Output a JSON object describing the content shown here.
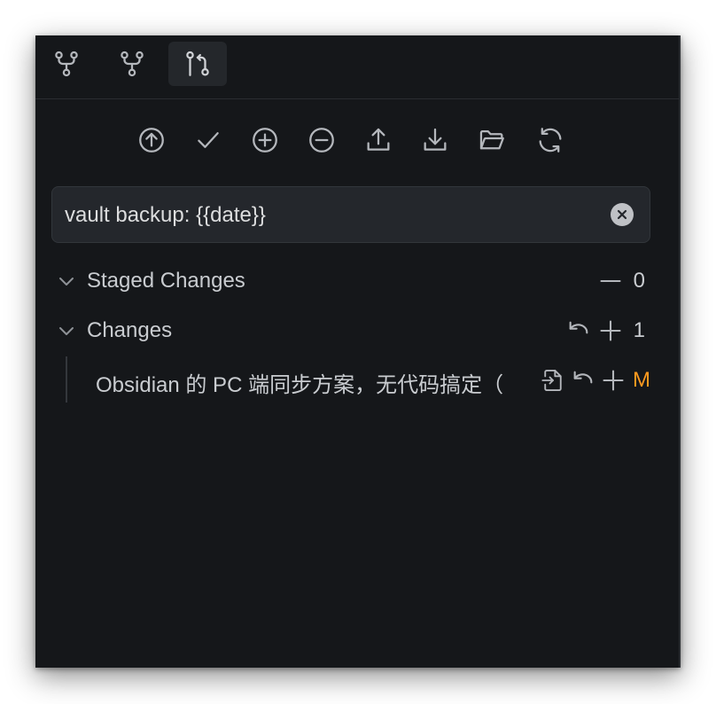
{
  "tabs": [
    {
      "name": "source-control-branch-tab",
      "icon": "git-fork-icon",
      "active": false
    },
    {
      "name": "source-control-fork-tab",
      "icon": "git-fork-icon",
      "active": false
    },
    {
      "name": "source-control-tab",
      "icon": "git-pull-request-icon",
      "active": true
    }
  ],
  "toolbar": {
    "icons": [
      "push-icon",
      "commit-check-icon",
      "stage-all-icon",
      "unstage-all-icon",
      "upload-icon",
      "download-icon",
      "folder-open-icon",
      "refresh-icon"
    ]
  },
  "commit": {
    "message": "vault backup: {{date}}",
    "clear_icon": "clear-circle-icon"
  },
  "staged": {
    "title": "Staged Changes",
    "count": "0"
  },
  "changes": {
    "title": "Changes",
    "count": "1",
    "files": [
      {
        "name": "Obsidian 的 PC 端同步方案，无代码搞定（",
        "status": "M"
      }
    ]
  },
  "colors": {
    "background": "#15171a",
    "text": "#c9ccd0",
    "icon": "#b4b7bc",
    "modified": "#ff9a1f"
  }
}
